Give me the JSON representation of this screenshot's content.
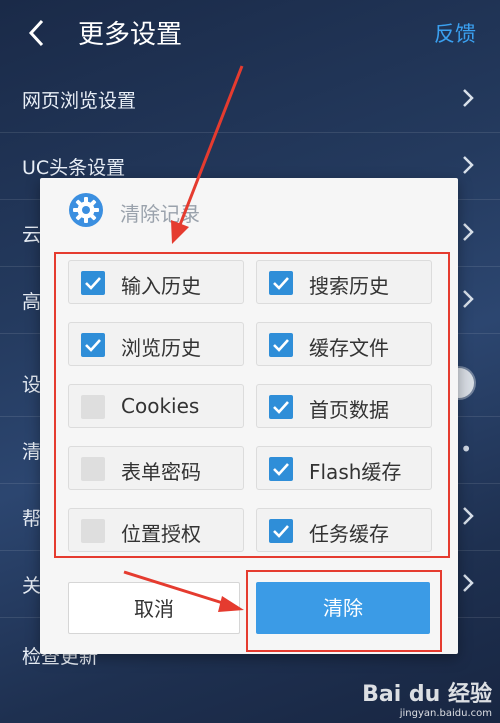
{
  "header": {
    "title": "更多设置",
    "feedback": "反馈"
  },
  "settings_rows": [
    {
      "label": "网页浏览设置"
    },
    {
      "label": "UC头条设置"
    },
    {
      "label": "云"
    },
    {
      "label": "高"
    },
    {
      "label": "设"
    },
    {
      "label": "清"
    },
    {
      "label": "帮"
    },
    {
      "label": "关于U"
    },
    {
      "label": "检查更新"
    }
  ],
  "dialog": {
    "title": "清除记录",
    "options": [
      {
        "label": "输入历史",
        "checked": true
      },
      {
        "label": "搜索历史",
        "checked": true
      },
      {
        "label": "浏览历史",
        "checked": true
      },
      {
        "label": "缓存文件",
        "checked": true
      },
      {
        "label": "Cookies",
        "checked": false
      },
      {
        "label": "首页数据",
        "checked": true
      },
      {
        "label": "表单密码",
        "checked": false
      },
      {
        "label": "Flash缓存",
        "checked": true
      },
      {
        "label": "位置授权",
        "checked": false
      },
      {
        "label": "任务缓存",
        "checked": true
      }
    ],
    "cancel_label": "取消",
    "clear_label": "清除"
  },
  "colors": {
    "accent": "#3b9be6",
    "checkbox": "#2f8ed8",
    "annotation": "#e53b2f",
    "feedback": "#3aa0f0"
  },
  "watermark": {
    "logo": "Bai du 经验",
    "url": "jingyan.baidu.com"
  }
}
